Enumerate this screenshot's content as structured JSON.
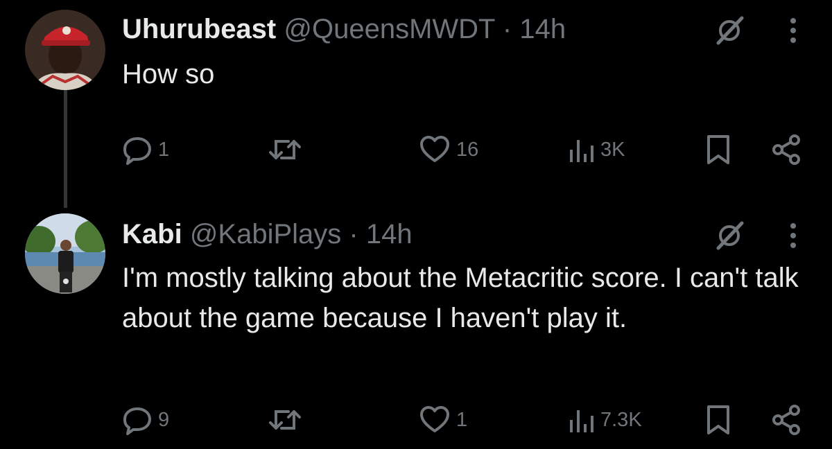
{
  "colors": {
    "background": "#000000",
    "text": "#e7e9ea",
    "muted": "#71767b",
    "thread_line": "#333639"
  },
  "tweets": [
    {
      "display_name": "Uhurubeast",
      "handle": "@QueensMWDT",
      "separator": "·",
      "time": "14h",
      "text": "How so",
      "replies": "1",
      "retweets": "",
      "likes": "16",
      "views": "3K",
      "icons": [
        "grok-icon",
        "more-icon",
        "reply-icon",
        "retweet-icon",
        "like-icon",
        "views-icon",
        "bookmark-icon",
        "share-icon"
      ]
    },
    {
      "display_name": "Kabi",
      "handle": "@KabiPlays",
      "separator": "·",
      "time": "14h",
      "text": "I'm mostly talking about the Metacritic score. I can't talk about the game because I haven't play it.",
      "replies": "9",
      "retweets": "",
      "likes": "1",
      "views": "7.3K",
      "icons": [
        "grok-icon",
        "more-icon",
        "reply-icon",
        "retweet-icon",
        "like-icon",
        "views-icon",
        "bookmark-icon",
        "share-icon"
      ]
    }
  ]
}
